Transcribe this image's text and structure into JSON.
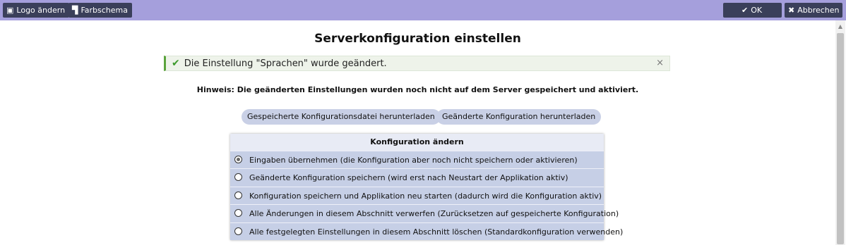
{
  "toolbar": {
    "logo_label": "Logo ändern",
    "logo_icon": "image-icon",
    "scheme_label": "Farbschema",
    "scheme_icon": "paint-roller-icon",
    "ok_label": "OK",
    "ok_icon": "check-icon",
    "cancel_label": "Abbrechen",
    "cancel_icon": "close-icon",
    "bar_color": "#a59fdc",
    "button_color": "#3a3f5a"
  },
  "page": {
    "title": "Serverkonfiguration einstellen"
  },
  "alert": {
    "message": "Die Einstellung \"Sprachen\" wurde geändert.",
    "icon": "check-icon",
    "close_icon": "close-icon",
    "close_glyph": "×",
    "accent_color": "#5aa33c"
  },
  "hint": "Hinweis: Die geänderten Einstellungen wurden noch nicht auf dem Server gespeichert und aktiviert.",
  "downloads": {
    "saved": "Gespeicherte Konfigurationsdatei herunterladen",
    "changed": "Geänderte Konfiguration herunterladen"
  },
  "config": {
    "heading": "Konfiguration ändern",
    "options": [
      {
        "label": "Eingaben übernehmen (die Konfiguration aber noch nicht speichern oder aktivieren)",
        "selected": true
      },
      {
        "label": "Geänderte Konfiguration speichern (wird erst nach Neustart der Applikation aktiv)",
        "selected": false
      },
      {
        "label": "Konfiguration speichern und Applikation neu starten (dadurch wird die Konfiguration aktiv)",
        "selected": false
      },
      {
        "label": "Alle Änderungen in diesem Abschnitt verwerfen (Zurücksetzen auf gespeicherte Konfiguration)",
        "selected": false
      },
      {
        "label": "Alle festgelegten Einstellungen in diesem Abschnitt löschen (Standardkonfiguration verwenden)",
        "selected": false
      }
    ]
  }
}
